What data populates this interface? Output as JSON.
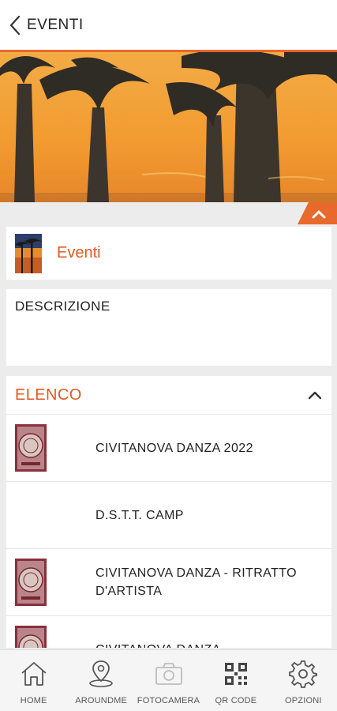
{
  "header": {
    "back_icon": "chevron-left-icon",
    "title": "EVENTI"
  },
  "colors": {
    "accent": "#e05a22",
    "header_rule": "#e8692c",
    "background": "#ececec"
  },
  "section": {
    "title": "Eventi",
    "collapse_icon": "chevron-up-icon"
  },
  "description": {
    "label": "DESCRIZIONE"
  },
  "list": {
    "header": "ELENCO",
    "toggle_icon": "chevron-up-icon",
    "items": [
      {
        "title": "CIVITANOVA DANZA 2022",
        "thumbnail": "poster-thumbnail"
      },
      {
        "title": "D.S.T.T. CAMP",
        "thumbnail": "none"
      },
      {
        "title": "CIVITANOVA DANZA - RITRATTO D'ARTISTA",
        "thumbnail": "poster-thumbnail"
      },
      {
        "title": "CIVITANOVA DANZA -",
        "thumbnail": "poster-thumbnail"
      }
    ]
  },
  "tabbar": {
    "tabs": [
      {
        "label": "HOME",
        "icon": "home-icon",
        "enabled": true
      },
      {
        "label": "AROUNDME",
        "icon": "map-pin-icon",
        "enabled": true
      },
      {
        "label": "FOTOCAMERA",
        "icon": "camera-icon",
        "enabled": false
      },
      {
        "label": "QR CODE",
        "icon": "qr-code-icon",
        "enabled": true
      },
      {
        "label": "OPZIONI",
        "icon": "gear-icon",
        "enabled": true
      }
    ]
  }
}
